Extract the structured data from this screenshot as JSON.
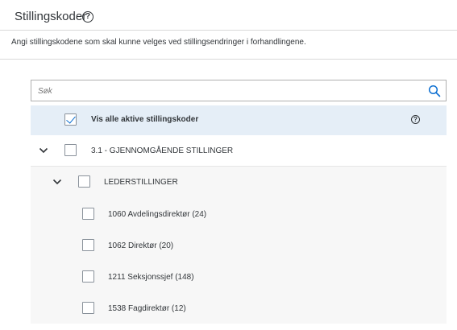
{
  "header": {
    "title": "Stillingskoder",
    "help_icon": "?"
  },
  "description": "Angi stillingskodene som skal kunne velges ved stillingsendringer i forhandlingene.",
  "search": {
    "placeholder": "Søk",
    "value": "",
    "icon": "search-icon"
  },
  "show_all": {
    "label": "Vis alle aktive stillingskoder",
    "checked": true,
    "help_icon": "?"
  },
  "group": {
    "label": "3.1 - GJENNOMGÅENDE STILLINGER",
    "expanded": true,
    "checked": false
  },
  "subgroup": {
    "label": "LEDERSTILLINGER",
    "expanded": true,
    "checked": false
  },
  "items": [
    {
      "label": "1060 Avdelingsdirektør (24)",
      "checked": false
    },
    {
      "label": "1062 Direktør (20)",
      "checked": false
    },
    {
      "label": "1211 Seksjonssjef (148)",
      "checked": false
    },
    {
      "label": "1538 Fagdirektør (12)",
      "checked": false
    }
  ],
  "colors": {
    "accent": "#0a6ed1",
    "selected_row": "#e5eef7",
    "nested_row": "#f7f7f7"
  }
}
